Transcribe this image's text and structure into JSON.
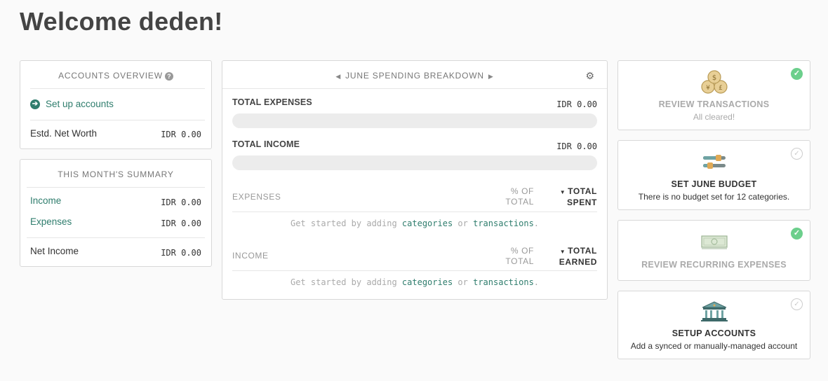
{
  "page": {
    "title": "Welcome deden!"
  },
  "accounts_overview": {
    "heading": "ACCOUNTS OVERVIEW",
    "help_icon": "?",
    "setup_link": "Set up accounts",
    "net_worth_label": "Estd. Net Worth",
    "net_worth_value": "IDR 0.00"
  },
  "summary": {
    "heading": "THIS MONTH'S SUMMARY",
    "income_label": "Income",
    "income_value": "IDR 0.00",
    "expenses_label": "Expenses",
    "expenses_value": "IDR 0.00",
    "net_label": "Net Income",
    "net_value": "IDR 0.00"
  },
  "breakdown": {
    "heading": "JUNE SPENDING BREAKDOWN",
    "total_expenses_label": "TOTAL EXPENSES",
    "total_expenses_value": "IDR 0.00",
    "total_income_label": "TOTAL INCOME",
    "total_income_value": "IDR 0.00",
    "expenses_col": "EXPENSES",
    "pct_line1": "% OF",
    "pct_line2": "TOTAL",
    "total_spent_line1": "TOTAL",
    "total_spent_line2": "SPENT",
    "income_col": "INCOME",
    "total_earned_line1": "TOTAL",
    "total_earned_line2": "EARNED",
    "empty_prefix": "Get started by adding",
    "empty_link1": "categories",
    "empty_mid": "or",
    "empty_link2": "transactions",
    "empty_suffix": "."
  },
  "tasks": [
    {
      "title": "REVIEW TRANSACTIONS",
      "subtitle": "All cleared!",
      "done": true,
      "icon": "coins-icon"
    },
    {
      "title": "SET JUNE BUDGET",
      "subtitle": "There is no budget set for 12 categories.",
      "done": false,
      "icon": "sliders-icon"
    },
    {
      "title": "REVIEW RECURRING EXPENSES",
      "subtitle": "",
      "done": true,
      "icon": "banknote-icon"
    },
    {
      "title": "SETUP ACCOUNTS",
      "subtitle": "Add a synced or manually-managed account",
      "done": false,
      "icon": "bank-icon"
    }
  ],
  "colors": {
    "accent": "#2f7d6d",
    "check": "#6ccf8c",
    "coin": "#e3c27a"
  }
}
